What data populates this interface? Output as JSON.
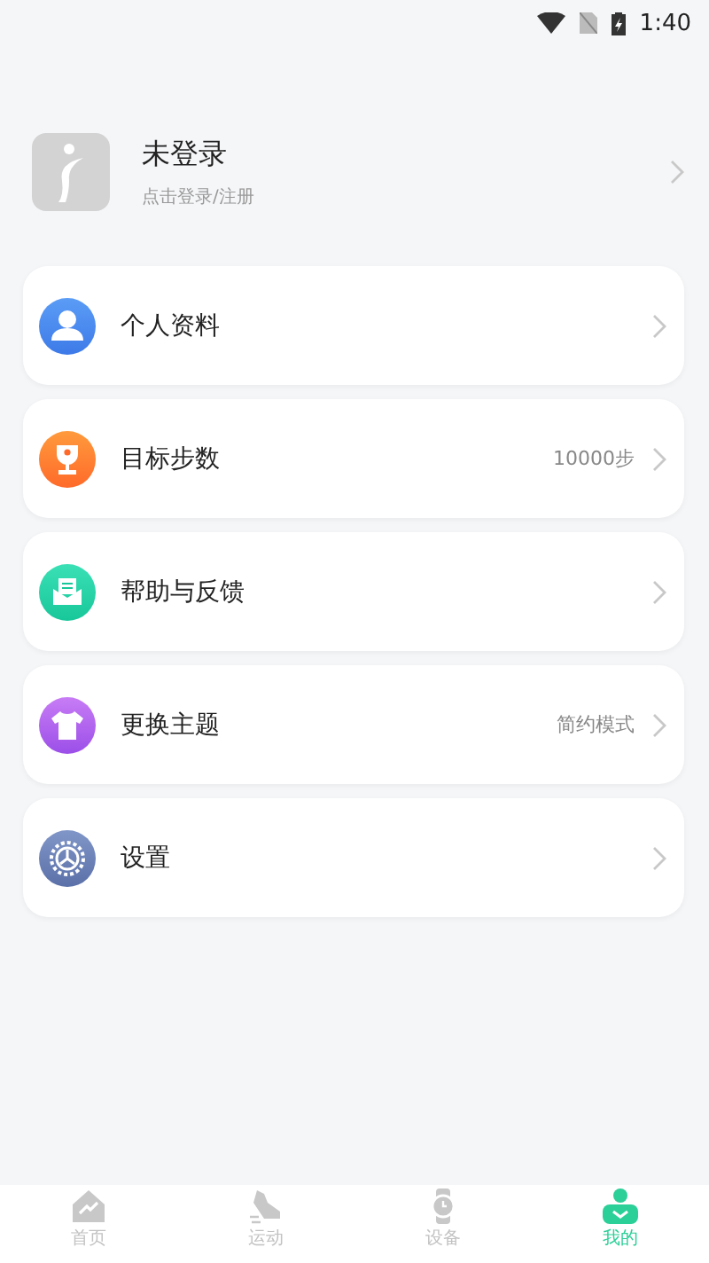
{
  "status_bar": {
    "time": "1:40"
  },
  "profile": {
    "name": "未登录",
    "hint": "点击登录/注册"
  },
  "menu": [
    {
      "kind": "person",
      "label": "个人资料"
    },
    {
      "kind": "trophy",
      "label": "目标步数",
      "value": "10000步"
    },
    {
      "kind": "mail",
      "label": "帮助与反馈"
    },
    {
      "kind": "shirt",
      "label": "更换主题",
      "value": "简约模式"
    },
    {
      "kind": "gear",
      "label": "设置"
    }
  ],
  "tabs": [
    {
      "kind": "home",
      "label": "首页",
      "selected": false
    },
    {
      "kind": "shoe",
      "label": "运动",
      "selected": false
    },
    {
      "kind": "watch",
      "label": "设备",
      "selected": false
    },
    {
      "kind": "me",
      "label": "我的",
      "selected": true
    }
  ]
}
